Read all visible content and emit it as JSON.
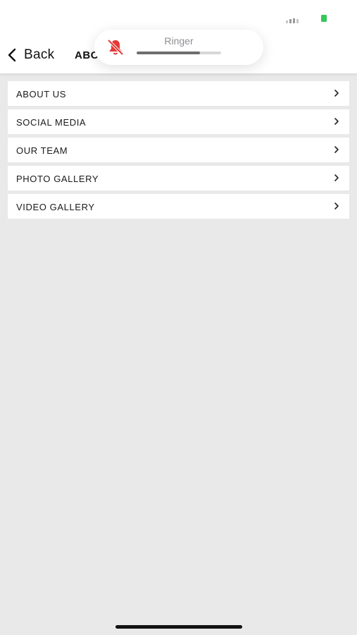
{
  "nav": {
    "back_label": "Back",
    "title": "ABOUT"
  },
  "ringer": {
    "label": "Ringer",
    "volume_fraction": 0.75,
    "muted": true,
    "muted_icon": "bell-slash-icon",
    "muted_color": "#e53935"
  },
  "menu": {
    "items": [
      {
        "label": "ABOUT US"
      },
      {
        "label": "SOCIAL MEDIA"
      },
      {
        "label": "OUR TEAM"
      },
      {
        "label": "PHOTO GALLERY"
      },
      {
        "label": "VIDEO GALLERY"
      }
    ]
  },
  "status": {
    "battery_color": "#34c759"
  },
  "colors": {
    "background": "#e9e9e9",
    "row_background": "#ffffff",
    "text": "#1a1a1a"
  }
}
